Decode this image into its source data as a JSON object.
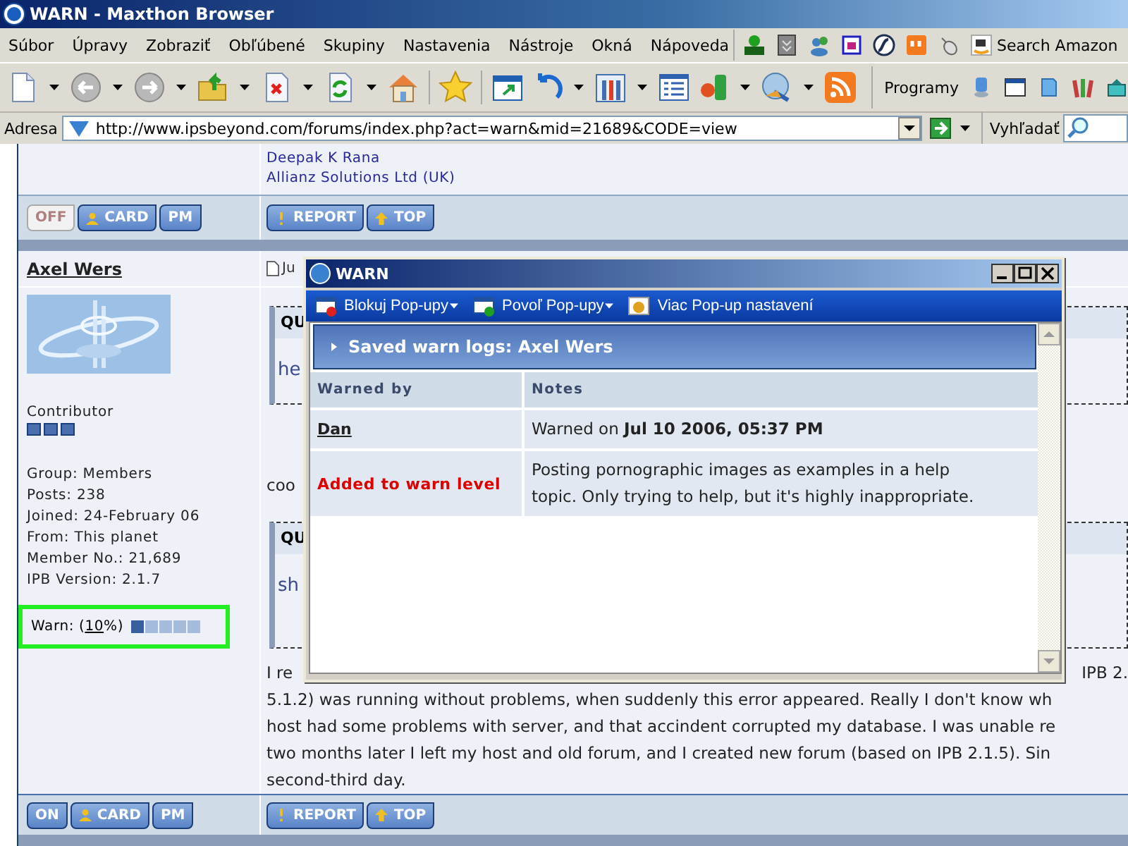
{
  "window": {
    "title": "WARN - Maxthon Browser"
  },
  "menu": [
    "Súbor",
    "Úpravy",
    "Zobraziť",
    "Obľúbené",
    "Skupiny",
    "Nastavenia",
    "Nástroje",
    "Okná",
    "Nápoveda"
  ],
  "toolbar": {
    "search_label": "Search Amazon",
    "programs_label": "Programy"
  },
  "address_bar": {
    "label": "Adresa",
    "url": "http://www.ipsbeyond.com/forums/index.php?act=warn&mid=21689&CODE=view",
    "search_label": "Vyhľadať"
  },
  "previous_post": {
    "signature": [
      "Deepak K Rana",
      "Allianz Solutions Ltd (UK)"
    ],
    "status_button": {
      "label": "OFF",
      "online": false
    },
    "buttons": [
      "CARD",
      "PM"
    ],
    "actions": [
      "REPORT",
      "TOP"
    ]
  },
  "post": {
    "author": "Axel Wers",
    "date": "Ju",
    "rank": "Contributor",
    "stars": 3,
    "info": [
      "Group: Members",
      "Posts: 238",
      "Joined: 24-February 06",
      "From: This planet",
      "Member No.: 21,689",
      "IPB Version: 2.1.7"
    ],
    "warn": {
      "prefix": "Warn: (",
      "link": "10",
      "suffix": "%)",
      "level": 0.2,
      "highlighted": true
    },
    "quotes": [
      {
        "heading": "QU",
        "text": "he"
      },
      {
        "heading": "QU",
        "text": "sh"
      }
    ],
    "between": "coo",
    "first_line": {
      "start": "I re",
      "end": "IPB 2."
    },
    "lines": [
      "5.1.2) was running without problems, when suddenly this error appeared. Really I don't know wh",
      "host had some problems with server, and that accindent corrupted my database. I was unable re",
      "two months later I left my host and old forum, and I created new forum (based on IPB 2.1.5). Sin",
      "second-third day."
    ],
    "status_button": {
      "label": "ON",
      "online": true
    },
    "buttons": [
      "CARD",
      "PM"
    ],
    "actions": [
      "REPORT",
      "TOP"
    ]
  },
  "popup": {
    "title": "WARN",
    "toolbar": [
      {
        "label": "Blokuj Pop-upy",
        "kind": "block",
        "dropdown": true
      },
      {
        "label": "Povoľ Pop-upy",
        "kind": "allow",
        "dropdown": true
      },
      {
        "label": "Viac Pop-up nastavení",
        "kind": "settings",
        "dropdown": false
      }
    ],
    "heading": "Saved warn logs: Axel Wers",
    "columns": [
      "Warned by",
      "Notes"
    ],
    "rows": [
      {
        "kind": "user",
        "warned_by": "Dan",
        "notes": "Warned on **Jul 10 2006, 05:37 PM**"
      },
      {
        "kind": "action",
        "warned_by": "Added to warn level",
        "notes": "Posting pornographic images as examples in a help topic. Only trying to help, but it's highly inappropriate."
      }
    ]
  }
}
